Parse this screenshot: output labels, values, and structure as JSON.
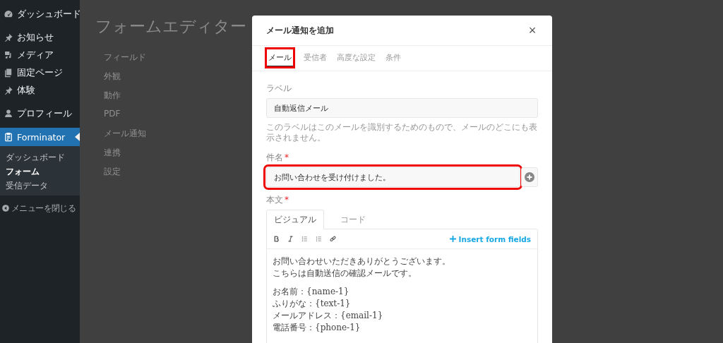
{
  "sidebar": {
    "groups": [
      [
        {
          "label": "ダッシュボード",
          "kind": "dashboard",
          "selected": false
        }
      ],
      [
        {
          "label": "お知らせ",
          "kind": "pin",
          "selected": false
        },
        {
          "label": "メディア",
          "kind": "media",
          "selected": false
        },
        {
          "label": "固定ページ",
          "kind": "pages",
          "selected": false
        },
        {
          "label": "体験",
          "kind": "pin",
          "selected": false
        }
      ],
      [
        {
          "label": "プロフィール",
          "kind": "user",
          "selected": false
        },
        {
          "label": "Forminator",
          "kind": "clipboard",
          "selected": true,
          "children": [
            {
              "label": "ダッシュボード",
              "selected": false
            },
            {
              "label": "フォーム",
              "selected": true
            },
            {
              "label": "受信データ",
              "selected": false
            }
          ]
        }
      ]
    ],
    "collapse": "メニューを閉じる"
  },
  "page": {
    "title": "フォームエディター",
    "nav": [
      "フィールド",
      "外観",
      "動作",
      "PDF",
      "メール通知",
      "連携",
      "設定"
    ]
  },
  "modal": {
    "title": "メール通知を追加",
    "close": "×",
    "tabs": [
      {
        "label": "メール",
        "selected": true,
        "highlighted": true
      },
      {
        "label": "受信者",
        "selected": false,
        "highlighted": false
      },
      {
        "label": "高度な設定",
        "selected": false,
        "highlighted": false
      },
      {
        "label": "条件",
        "selected": false,
        "highlighted": false
      }
    ],
    "label_field": {
      "label": "ラベル",
      "value": "自動返信メール",
      "help": "このラベルはこのメールを識別するためのもので、メールのどこにも表示されません。"
    },
    "subject_field": {
      "label": "件名",
      "required_mark": "*",
      "value": "お問い合わせを受け付けました。",
      "highlighted": true
    },
    "body_field": {
      "label": "本文",
      "required_mark": "*",
      "editor_tabs": [
        {
          "label": "ビジュアル",
          "selected": true
        },
        {
          "label": "コード",
          "selected": false
        }
      ],
      "insert_link": "Insert form fields",
      "paragraphs": [
        [
          "お問い合わせいただきありがとうございます。",
          "こちらは自動送信の確認メールです。"
        ],
        [
          "お名前：{name-1}",
          "ふりがな：{text-1}",
          "メールアドレス：{email-1}",
          "電話番号：{phone-1}"
        ]
      ]
    }
  }
}
